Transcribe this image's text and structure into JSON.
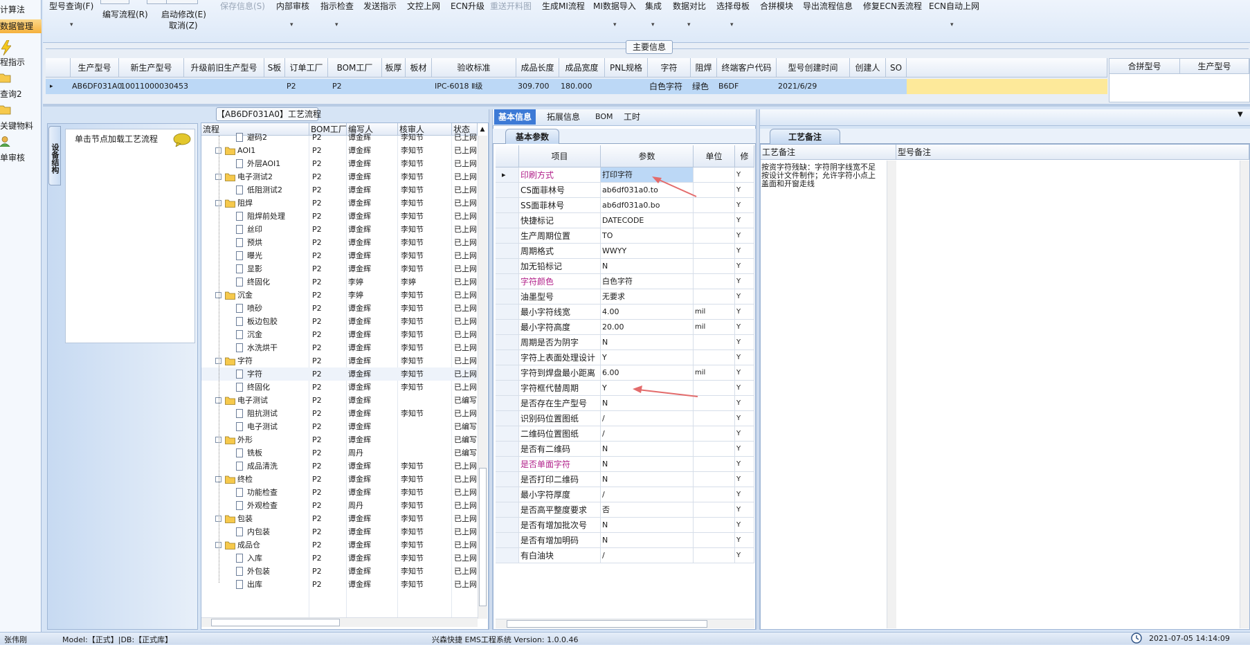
{
  "left_nav": {
    "items": [
      {
        "label": "计算法",
        "active": false
      },
      {
        "label": "数据管理",
        "active": true
      },
      {
        "label": "程指示"
      },
      {
        "label": "查询2"
      },
      {
        "label": "关键物料"
      },
      {
        "label": "单审核"
      }
    ]
  },
  "toolbar": {
    "items": [
      {
        "label": "型号查询(F)",
        "dropdown": true
      },
      {
        "label": "编写流程(R)",
        "dropdown": false
      },
      {
        "label": "启动修改(E)",
        "sub": "取消(Z)"
      },
      {
        "label": "保存信息(S)",
        "disabled": true
      },
      {
        "label": "内部审核",
        "dropdown": true
      },
      {
        "label": "指示检查",
        "dropdown": true
      },
      {
        "label": "发送指示"
      },
      {
        "label": "文控上网"
      },
      {
        "label": "ECN升级"
      },
      {
        "label": "重送开料图",
        "disabled": true
      },
      {
        "label": "生成MI流程"
      },
      {
        "label": "MI数据导入",
        "dropdown": true
      },
      {
        "label": "集成",
        "dropdown": true
      },
      {
        "label": "数据对比",
        "dropdown": true
      },
      {
        "label": "选择母板",
        "dropdown": true
      },
      {
        "label": "合拼模块"
      },
      {
        "label": "导出流程信息"
      },
      {
        "label": "修复ECN丢流程"
      },
      {
        "label": "ECN自动上网",
        "dropdown": true
      }
    ]
  },
  "main_info": {
    "title": "主要信息",
    "columns": [
      "生产型号",
      "新生产型号",
      "升级前旧生产型号",
      "S板",
      "订单工厂",
      "BOM工厂",
      "板厚",
      "板材",
      "验收标准",
      "成品长度",
      "成品宽度",
      "PNL规格",
      "字符",
      "阻焊",
      "终端客户代码",
      "型号创建时间",
      "创建人",
      "SO"
    ],
    "row": {
      "production_model": "AB6DF031A0",
      "new_model": "10011000030453",
      "order_factory": "P2",
      "bom_factory": "P2",
      "standard": "IPC-6018 Ⅱ级",
      "length": "309.700",
      "width": "180.000",
      "char": "白色字符",
      "mask": "绿色",
      "customer": "B6DF",
      "created": "2021/6/29"
    },
    "side_columns": [
      "合拼型号",
      "生产型号"
    ]
  },
  "device_panel": {
    "tab": "设备结构",
    "hint": "单击节点加载工艺流程"
  },
  "process": {
    "title": "【AB6DF031A0】工艺流程",
    "columns": [
      "流程",
      "BOM工厂",
      "编写人",
      "核审人",
      "状态"
    ],
    "rows": [
      {
        "name": "避码2",
        "level": 2,
        "factory": "P2",
        "writer": "谭金辉",
        "reviewer": "李知节",
        "status": "已上网"
      },
      {
        "name": "AOI1",
        "level": 1,
        "factory": "P2",
        "writer": "谭金辉",
        "reviewer": "李知节",
        "status": "已上网"
      },
      {
        "name": "外层AOI1",
        "level": 2,
        "factory": "P2",
        "writer": "谭金辉",
        "reviewer": "李知节",
        "status": "已上网"
      },
      {
        "name": "电子测试2",
        "level": 1,
        "factory": "P2",
        "writer": "谭金辉",
        "reviewer": "李知节",
        "status": "已上网"
      },
      {
        "name": "低阻测试2",
        "level": 2,
        "factory": "P2",
        "writer": "谭金辉",
        "reviewer": "李知节",
        "status": "已上网"
      },
      {
        "name": "阻焊",
        "level": 1,
        "factory": "P2",
        "writer": "谭金辉",
        "reviewer": "李知节",
        "status": "已上网"
      },
      {
        "name": "阻焊前处理",
        "level": 2,
        "factory": "P2",
        "writer": "谭金辉",
        "reviewer": "李知节",
        "status": "已上网"
      },
      {
        "name": "丝印",
        "level": 2,
        "factory": "P2",
        "writer": "谭金辉",
        "reviewer": "李知节",
        "status": "已上网"
      },
      {
        "name": "预烘",
        "level": 2,
        "factory": "P2",
        "writer": "谭金辉",
        "reviewer": "李知节",
        "status": "已上网"
      },
      {
        "name": "曝光",
        "level": 2,
        "factory": "P2",
        "writer": "谭金辉",
        "reviewer": "李知节",
        "status": "已上网"
      },
      {
        "name": "显影",
        "level": 2,
        "factory": "P2",
        "writer": "谭金辉",
        "reviewer": "李知节",
        "status": "已上网"
      },
      {
        "name": "终固化",
        "level": 2,
        "factory": "P2",
        "writer": "李婷",
        "reviewer": "李婷",
        "status": "已上网"
      },
      {
        "name": "沉金",
        "level": 1,
        "factory": "P2",
        "writer": "李婷",
        "reviewer": "李知节",
        "status": "已上网"
      },
      {
        "name": "喷砂",
        "level": 2,
        "factory": "P2",
        "writer": "谭金辉",
        "reviewer": "李知节",
        "status": "已上网"
      },
      {
        "name": "板边包胶",
        "level": 2,
        "factory": "P2",
        "writer": "谭金辉",
        "reviewer": "李知节",
        "status": "已上网"
      },
      {
        "name": "沉金",
        "level": 2,
        "factory": "P2",
        "writer": "谭金辉",
        "reviewer": "李知节",
        "status": "已上网"
      },
      {
        "name": "水洗烘干",
        "level": 2,
        "factory": "P2",
        "writer": "谭金辉",
        "reviewer": "李知节",
        "status": "已上网"
      },
      {
        "name": "字符",
        "level": 1,
        "factory": "P2",
        "writer": "谭金辉",
        "reviewer": "李知节",
        "status": "已上网"
      },
      {
        "name": "字符",
        "level": 2,
        "factory": "P2",
        "writer": "谭金辉",
        "reviewer": "李知节",
        "status": "已上网",
        "selected": true
      },
      {
        "name": "终固化",
        "level": 2,
        "factory": "P2",
        "writer": "谭金辉",
        "reviewer": "李知节",
        "status": "已上网"
      },
      {
        "name": "电子测试",
        "level": 1,
        "factory": "P2",
        "writer": "谭金辉",
        "reviewer": "",
        "status": "已编写"
      },
      {
        "name": "阻抗测试",
        "level": 2,
        "factory": "P2",
        "writer": "谭金辉",
        "reviewer": "李知节",
        "status": "已上网"
      },
      {
        "name": "电子测试",
        "level": 2,
        "factory": "P2",
        "writer": "谭金辉",
        "reviewer": "",
        "status": "已编写"
      },
      {
        "name": "外形",
        "level": 1,
        "factory": "P2",
        "writer": "谭金辉",
        "reviewer": "",
        "status": "已编写"
      },
      {
        "name": "铣板",
        "level": 2,
        "factory": "P2",
        "writer": "周丹",
        "reviewer": "",
        "status": "已编写"
      },
      {
        "name": "成品清洗",
        "level": 2,
        "factory": "P2",
        "writer": "谭金辉",
        "reviewer": "李知节",
        "status": "已上网"
      },
      {
        "name": "终检",
        "level": 1,
        "factory": "P2",
        "writer": "谭金辉",
        "reviewer": "李知节",
        "status": "已上网"
      },
      {
        "name": "功能检查",
        "level": 2,
        "factory": "P2",
        "writer": "谭金辉",
        "reviewer": "李知节",
        "status": "已上网"
      },
      {
        "name": "外观检查",
        "level": 2,
        "factory": "P2",
        "writer": "周丹",
        "reviewer": "李知节",
        "status": "已上网"
      },
      {
        "name": "包装",
        "level": 1,
        "factory": "P2",
        "writer": "谭金辉",
        "reviewer": "李知节",
        "status": "已上网"
      },
      {
        "name": "内包装",
        "level": 2,
        "factory": "P2",
        "writer": "谭金辉",
        "reviewer": "李知节",
        "status": "已上网"
      },
      {
        "name": "成品仓",
        "level": 1,
        "factory": "P2",
        "writer": "谭金辉",
        "reviewer": "李知节",
        "status": "已上网"
      },
      {
        "name": "入库",
        "level": 2,
        "factory": "P2",
        "writer": "谭金辉",
        "reviewer": "李知节",
        "status": "已上网"
      },
      {
        "name": "外包装",
        "level": 2,
        "factory": "P2",
        "writer": "谭金辉",
        "reviewer": "李知节",
        "status": "已上网"
      },
      {
        "name": "出库",
        "level": 2,
        "factory": "P2",
        "writer": "谭金辉",
        "reviewer": "李知节",
        "status": "已上网"
      }
    ]
  },
  "params": {
    "tabs": [
      "基本信息",
      "拓展信息",
      "BOM",
      "工时"
    ],
    "subtab": "基本参数",
    "columns": [
      "项目",
      "参数",
      "单位",
      "修"
    ],
    "rows": [
      {
        "name": "印刷方式",
        "value": "打印字符",
        "unit": "",
        "flag": "Y",
        "hl": true,
        "selected": true
      },
      {
        "name": "CS面菲林号",
        "value": "ab6df031a0.to",
        "unit": "",
        "flag": "Y"
      },
      {
        "name": "SS面菲林号",
        "value": "ab6df031a0.bo",
        "unit": "",
        "flag": "Y"
      },
      {
        "name": "快捷标记",
        "value": "DATECODE",
        "unit": "",
        "flag": "Y"
      },
      {
        "name": "生产周期位置",
        "value": "TO",
        "unit": "",
        "flag": "Y"
      },
      {
        "name": "周期格式",
        "value": "WWYY",
        "unit": "",
        "flag": "Y"
      },
      {
        "name": "加无铅标记",
        "value": "N",
        "unit": "",
        "flag": "Y"
      },
      {
        "name": "字符颜色",
        "value": "白色字符",
        "unit": "",
        "flag": "Y",
        "hl": true
      },
      {
        "name": "油墨型号",
        "value": "无要求",
        "unit": "",
        "flag": "Y"
      },
      {
        "name": "最小字符线宽",
        "value": "4.00",
        "unit": "mil",
        "flag": "Y"
      },
      {
        "name": "最小字符高度",
        "value": "20.00",
        "unit": "mil",
        "flag": "Y"
      },
      {
        "name": "周期是否为阴字",
        "value": "N",
        "unit": "",
        "flag": "Y"
      },
      {
        "name": "字符上表面处理设计",
        "value": "Y",
        "unit": "",
        "flag": "Y"
      },
      {
        "name": "字符到焊盘最小距离",
        "value": "6.00",
        "unit": "mil",
        "flag": "Y"
      },
      {
        "name": "字符框代替周期",
        "value": "Y",
        "unit": "",
        "flag": "Y"
      },
      {
        "name": "是否存在生产型号",
        "value": "N",
        "unit": "",
        "flag": "Y"
      },
      {
        "name": "识别码位置图纸",
        "value": "/",
        "unit": "",
        "flag": "Y"
      },
      {
        "name": "二维码位置图纸",
        "value": "/",
        "unit": "",
        "flag": "Y"
      },
      {
        "name": "是否有二维码",
        "value": "N",
        "unit": "",
        "flag": "Y"
      },
      {
        "name": "是否单面字符",
        "value": "N",
        "unit": "",
        "flag": "Y",
        "hl": true
      },
      {
        "name": "是否打印二维码",
        "value": "N",
        "unit": "",
        "flag": "Y"
      },
      {
        "name": "最小字符厚度",
        "value": "/",
        "unit": "",
        "flag": "Y"
      },
      {
        "name": "是否高平整度要求",
        "value": "否",
        "unit": "",
        "flag": "Y"
      },
      {
        "name": "是否有增加批次号",
        "value": "N",
        "unit": "",
        "flag": "Y"
      },
      {
        "name": "是否有增加明码",
        "value": "N",
        "unit": "",
        "flag": "Y"
      },
      {
        "name": "有白油块",
        "value": "/",
        "unit": "",
        "flag": "Y"
      }
    ]
  },
  "notes": {
    "tab": "工艺备注",
    "col1": "工艺备注",
    "col2": "型号备注",
    "text": "按资字符残缺：字符阴字线宽不足按设计文件制作；允许字符小点上盖面和开窗走线"
  },
  "status_bar": {
    "user": "张伟刚",
    "model": "Model:【正式】|DB:【正式库】",
    "system": "兴森快捷 EMS工程系统 Version: 1.0.0.46",
    "time": "2021-07-05 14:14:09"
  },
  "colors": {
    "accent": "#3d7ad6",
    "selection": "#bcd8f6",
    "highlight": "#b1208a",
    "yellow": "#fde99a",
    "arrow": "#e36b6b"
  }
}
